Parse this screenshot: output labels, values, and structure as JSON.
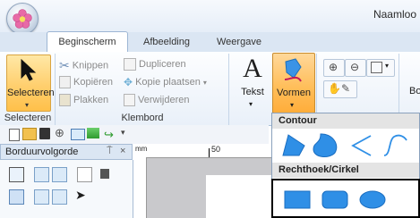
{
  "window": {
    "title": "Naamloo"
  },
  "tabs": [
    {
      "label": "Beginscherm"
    },
    {
      "label": "Afbeelding"
    },
    {
      "label": "Weergave"
    }
  ],
  "ribbon": {
    "select": {
      "label": "Selecteren"
    },
    "select_group_label": "Selecteren",
    "clipboard": {
      "knippen": "Knippen",
      "kopieren": "Kopiëren",
      "plakken": "Plakken",
      "dupliceren": "Dupliceren",
      "kopie_plaatsen": "Kopie plaatsen",
      "verwijderen": "Verwijderen",
      "group_label": "Klembord"
    },
    "tekst": {
      "label": "Tekst",
      "glyph": "A"
    },
    "vormen": {
      "label": "Vormen"
    },
    "partial_label": "Bo"
  },
  "panel": {
    "title": "Borduurvolgorde",
    "pin": "⍑",
    "close": "×"
  },
  "ruler": {
    "unit": "mm",
    "tick_50": "50"
  },
  "dropdown": {
    "contour_label": "Contour",
    "rect_label": "Rechthoek/Cirkel"
  },
  "colors": {
    "accent": "#1a7fd4",
    "shape_fill": "#2f8fe6",
    "select_orange": "#ffcf6e"
  }
}
